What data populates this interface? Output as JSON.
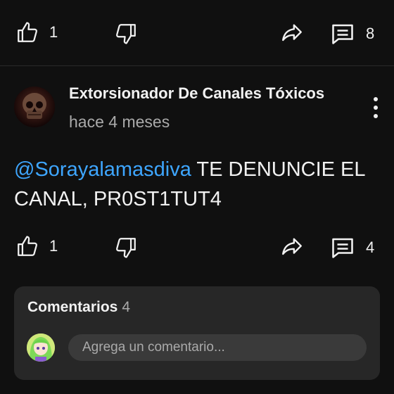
{
  "top_actions": {
    "like_count": "1",
    "reply_count": "8"
  },
  "comment": {
    "author": "Extorsionador De Canales Tóxicos",
    "time": "hace 4 meses",
    "mention": "@Sorayalamasdiva",
    "text": " TE DENUNCIE EL CANAL, PR0ST1TUT4",
    "like_count": "1",
    "reply_count": "4"
  },
  "comments_panel": {
    "title": "Comentarios",
    "count": "4",
    "input_placeholder": "Agrega un comentario..."
  },
  "icons": {
    "like": "thumb-up-icon",
    "dislike": "thumb-down-icon",
    "share": "share-icon",
    "replies": "comment-icon",
    "more": "more-vert-icon"
  },
  "colors": {
    "background": "#101010",
    "mention": "#3ea6ff",
    "card": "#272727",
    "input": "#3a3a3a",
    "secondary_text": "#aaaaaa"
  }
}
